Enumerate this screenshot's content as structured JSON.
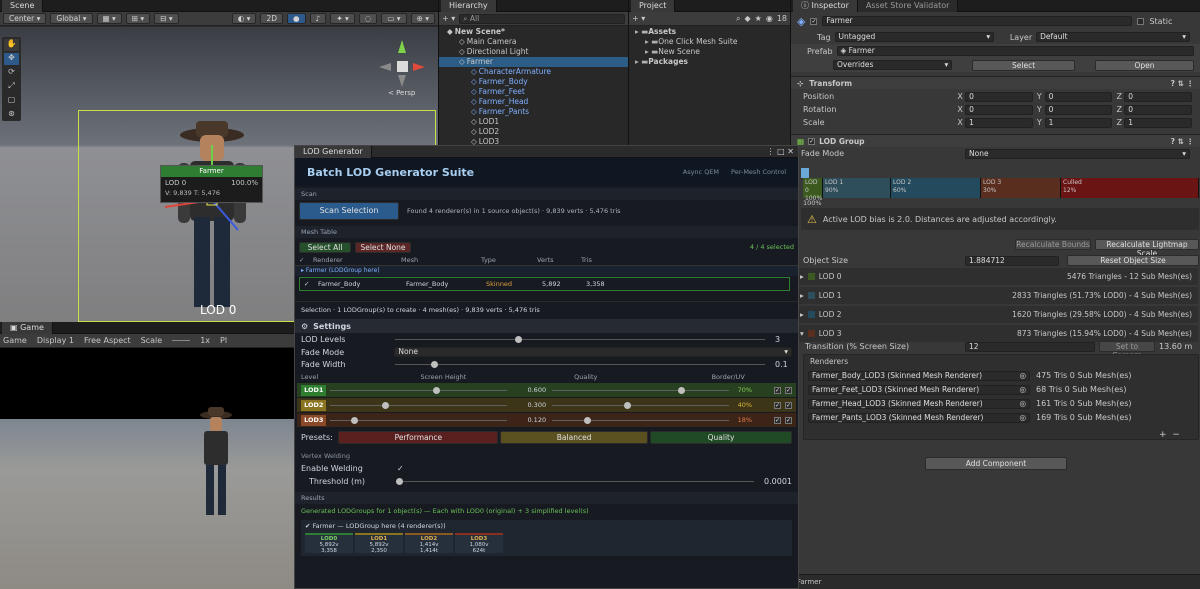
{
  "scene": {
    "tab": "Scene",
    "pivot": "Center",
    "space": "Global",
    "mode2d": "2D",
    "persp": "< Persp",
    "overlay_title": "Farmer",
    "overlay_lod": "LOD 0",
    "overlay_pct": "100.0%",
    "overlay_stats": "V: 9,839   T: 5,476",
    "lod_label": "LOD 0"
  },
  "game": {
    "tab": "Game",
    "display": "Game",
    "display_n": "Display 1",
    "aspect": "Free Aspect",
    "scale": "Scale",
    "scale_val": "1x",
    "pl": "Pl"
  },
  "hierarchy": {
    "tab": "Hierarchy",
    "search": "All",
    "items": [
      {
        "label": "New Scene*",
        "indent": 0,
        "bold": true,
        "blue": false
      },
      {
        "label": "Main Camera",
        "indent": 1,
        "bold": false,
        "blue": false
      },
      {
        "label": "Directional Light",
        "indent": 1,
        "bold": false,
        "blue": false
      },
      {
        "label": "Farmer",
        "indent": 1,
        "bold": false,
        "blue": false,
        "selected": true
      },
      {
        "label": "CharacterArmature",
        "indent": 2,
        "bold": false,
        "blue": true
      },
      {
        "label": "Farmer_Body",
        "indent": 2,
        "bold": false,
        "blue": true
      },
      {
        "label": "Farmer_Feet",
        "indent": 2,
        "bold": false,
        "blue": true
      },
      {
        "label": "Farmer_Head",
        "indent": 2,
        "bold": false,
        "blue": true
      },
      {
        "label": "Farmer_Pants",
        "indent": 2,
        "bold": false,
        "blue": true
      },
      {
        "label": "LOD1",
        "indent": 2,
        "bold": false,
        "blue": false
      },
      {
        "label": "LOD2",
        "indent": 2,
        "bold": false,
        "blue": false
      },
      {
        "label": "LOD3",
        "indent": 2,
        "bold": false,
        "blue": false
      }
    ]
  },
  "project": {
    "tab": "Project",
    "count": "18",
    "items": [
      {
        "label": "Assets",
        "indent": 0,
        "bold": true
      },
      {
        "label": "One Click Mesh Suite",
        "indent": 1,
        "bold": false
      },
      {
        "label": "New Scene",
        "indent": 1,
        "bold": false
      },
      {
        "label": "Packages",
        "indent": 0,
        "bold": true
      }
    ]
  },
  "generator": {
    "tab": "LOD Generator",
    "title": "Batch LOD Generator Suite",
    "tag1": "Async QEM",
    "tag2": "Per-Mesh Control",
    "scan_label": "Scan",
    "scan_button": "Scan Selection",
    "scan_info": "Found 4 renderer(s) in 1 source object(s)  ·  9,839 verts  ·  5,476 tris",
    "mesh_table": "Mesh Table",
    "select_all": "Select All",
    "select_none": "Select None",
    "selected_count": "4 / 4 selected",
    "cols": [
      "Renderer",
      "Mesh",
      "Type",
      "Verts",
      "Tris"
    ],
    "group_label": "▸ Farmer  (LODGroup here)",
    "row": {
      "renderer": "Farmer_Body",
      "mesh": "Farmer_Body",
      "type": "Skinned",
      "verts": "5,892",
      "tris": "3,358"
    },
    "selection_info": "Selection  ·  1 LODGroup(s) to create  ·  4 mesh(es)  ·  9,839 verts  ·  5,476 tris",
    "settings": "Settings",
    "lod_levels_label": "LOD Levels",
    "lod_levels": "3",
    "fade_mode_label": "Fade Mode",
    "fade_mode": "None",
    "fade_width_label": "Fade Width",
    "fade_width": "0.1",
    "level_cols": [
      "Level",
      "Screen Height",
      "Quality",
      "Border/UV"
    ],
    "levels": [
      {
        "name": "LOD1",
        "height": "0.600",
        "height_frac": 0.6,
        "quality": "70%",
        "quality_frac": 0.7,
        "bg": "#27401f",
        "tag": "#2f7d2f",
        "qcolor": "#86c95a"
      },
      {
        "name": "LOD2",
        "height": "0.300",
        "height_frac": 0.3,
        "quality": "40%",
        "quality_frac": 0.4,
        "bg": "#3d3517",
        "tag": "#8a7420",
        "qcolor": "#d8b53d"
      },
      {
        "name": "LOD3",
        "height": "0.120",
        "height_frac": 0.12,
        "quality": "18%",
        "quality_frac": 0.18,
        "bg": "#3d2418",
        "tag": "#8a4a28",
        "qcolor": "#e07a45"
      }
    ],
    "presets_label": "Presets:",
    "preset_perf": "Performance",
    "preset_bal": "Balanced",
    "preset_qual": "Quality",
    "vertex_welding": "Vertex Welding",
    "enable_welding": "Enable Welding",
    "threshold_label": "Threshold (m)",
    "threshold": "0.0001",
    "results": "Results",
    "results_info": "Generated LODGroups for 1 object(s)  —  Each with LOD0 (original) + 3 simplified level(s)",
    "result_group": "✔ Farmer — LODGroup here (4 renderer(s))",
    "result_cols": [
      {
        "name": "LOD0",
        "a": "5,892v",
        "b": "3,358"
      },
      {
        "name": "LOD1",
        "a": "5,892v",
        "b": "2,350"
      },
      {
        "name": "LOD2",
        "a": "1,414v",
        "b": "1,414t"
      },
      {
        "name": "LOD3",
        "a": "1,080v",
        "b": "624t"
      }
    ]
  },
  "inspector": {
    "tab": "Inspector",
    "tab2": "Asset Store Validator",
    "name": "Farmer",
    "static": "Static",
    "tag_label": "Tag",
    "tag": "Untagged",
    "layer_label": "Layer",
    "layer": "Default",
    "prefab_label": "Prefab",
    "prefab": "Farmer",
    "overrides": "Overrides",
    "select": "Select",
    "open": "Open",
    "transform": "Transform",
    "position_label": "Position",
    "rotation_label": "Rotation",
    "scale_label": "Scale",
    "position": [
      "0",
      "0",
      "0"
    ],
    "rotation": [
      "0",
      "0",
      "0"
    ],
    "scale": [
      "1",
      "1",
      "1"
    ],
    "lodgroup": "LOD Group",
    "fade_mode_label": "Fade Mode",
    "fade_mode": "None",
    "bars": [
      {
        "label": "LOD 0",
        "pct": "100%",
        "color": "#3c5a1f"
      },
      {
        "label": "LOD 1",
        "pct": "90%",
        "color": "#2f4e5c"
      },
      {
        "label": "LOD 2",
        "pct": "60%",
        "color": "#244a5e"
      },
      {
        "label": "LOD 3",
        "pct": "30%",
        "color": "#5a2e1e"
      },
      {
        "label": "Culled",
        "pct": "12%",
        "color": "#6b1414"
      }
    ],
    "bar_left": "100%",
    "warning": "Active LOD bias is 2.0. Distances are adjusted accordingly.",
    "recalc_bounds": "Recalculate Bounds",
    "recalc_lightmap": "Recalculate Lightmap Scale",
    "object_size_label": "Object Size",
    "object_size": "1.884712",
    "reset_size": "Reset Object Size",
    "lods": [
      {
        "name": "LOD 0",
        "info": "5476 Triangles  - 12 Sub Mesh(es)",
        "color": "#3c5a1f"
      },
      {
        "name": "LOD 1",
        "info": "2833 Triangles (51.73% LOD0) - 4 Sub Mesh(es)",
        "color": "#2f4e5c"
      },
      {
        "name": "LOD 2",
        "info": "1620 Triangles (29.58% LOD0) - 4 Sub Mesh(es)",
        "color": "#244a5e"
      },
      {
        "name": "LOD 3",
        "info": "873 Triangles (15.94% LOD0) - 4 Sub Mesh(es)",
        "color": "#5a2e1e"
      }
    ],
    "transition_label": "Transition (% Screen Size)",
    "transition": "12",
    "set_camera": "Set to Camera",
    "distance": "13.60 m",
    "renderers_label": "Renderers",
    "renderers": [
      {
        "name": "Farmer_Body_LOD3 (Skinned Mesh Renderer)",
        "info": "475 Tris  0 Sub Mesh(es)"
      },
      {
        "name": "Farmer_Feet_LOD3 (Skinned Mesh Renderer)",
        "info": "68 Tris  0 Sub Mesh(es)"
      },
      {
        "name": "Farmer_Head_LOD3 (Skinned Mesh Renderer)",
        "info": "161 Tris  0 Sub Mesh(es)"
      },
      {
        "name": "Farmer_Pants_LOD3 (Skinned Mesh Renderer)",
        "info": "169 Tris  0 Sub Mesh(es)"
      }
    ],
    "add_component": "Add Component",
    "footer": "Farmer"
  }
}
